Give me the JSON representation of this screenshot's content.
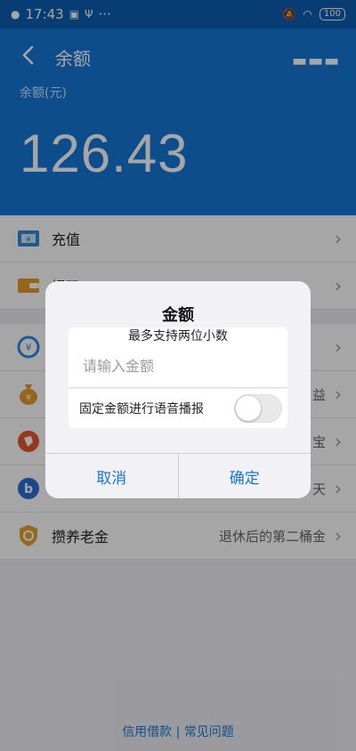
{
  "status": {
    "time": "17:43",
    "battery": "100",
    "icons": [
      "app-icon",
      "usb-icon",
      "more-dots-icon",
      "mute-icon",
      "wifi-icon"
    ]
  },
  "nav": {
    "title": "余额"
  },
  "balance": {
    "label": "余额(元)",
    "amount": "126.43"
  },
  "list": {
    "recharge": "充值",
    "withdraw": "提现",
    "pension": "攒养老金",
    "pension_desc": "退休后的第二桶金",
    "partial": [
      "益",
      "宝",
      "天"
    ]
  },
  "footer": {
    "loan": "信用借款",
    "sep": "|",
    "faq": "常见问题"
  },
  "dialog": {
    "title": "金额",
    "subtitle": "最多支持两位小数",
    "placeholder": "请输入金额",
    "toggle_label": "固定金额进行语音播报",
    "toggle_on": false,
    "cancel": "取消",
    "confirm": "确定"
  },
  "colors": {
    "header": "#1677d8",
    "statusbar": "#0b5fb0",
    "accent": "#1677d8"
  }
}
